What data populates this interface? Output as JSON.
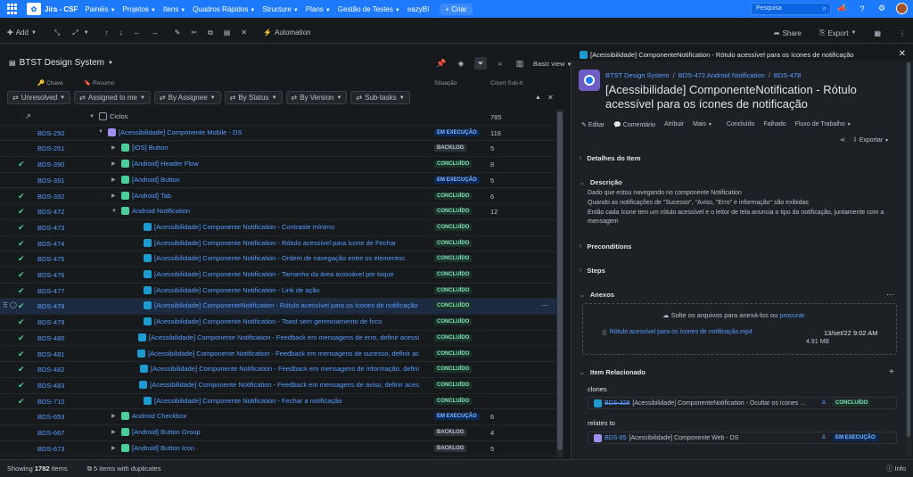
{
  "topnav": {
    "app_name": "Jira - CSF",
    "items": [
      "Painéis",
      "Projetos",
      "Itens",
      "Quadros Rápidos",
      "Structure",
      "Plans",
      "Gestão de Testes",
      "eazyBI"
    ],
    "create_label": "+ Criar",
    "search_placeholder": "Pesquisa"
  },
  "toolbar": {
    "add_label": "Add",
    "automation_label": "Automation",
    "share_label": "Share",
    "export_label": "Export"
  },
  "structure": {
    "title": "BTST Design System",
    "view_label": "Basic view",
    "columns": {
      "key": "Chave",
      "summary": "Resumo",
      "status": "Situação",
      "count": "Count Sub-It"
    },
    "filters": [
      "Unresolved",
      "Assigned to me",
      "By Assignee",
      "By Status",
      "By Version",
      "Sub-tasks"
    ]
  },
  "rows": [
    {
      "check": false,
      "key": "",
      "level": 0,
      "expand": "down",
      "type": "folder",
      "summary": "Ciclos",
      "link": false,
      "status": "",
      "st": "",
      "count": "785"
    },
    {
      "check": false,
      "key": "BDS-250",
      "level": 1,
      "expand": "down",
      "type": "epic",
      "summary": "[Acessibilidade] Componente Mobile - DS",
      "link": true,
      "status": "EM EXECUÇÃO",
      "st": "prog",
      "count": "116"
    },
    {
      "check": false,
      "key": "BDS-251",
      "level": 2,
      "expand": "right",
      "type": "story",
      "summary": "[iOS] Button",
      "link": true,
      "status": "BACKLOG",
      "st": "back",
      "count": "5"
    },
    {
      "check": true,
      "key": "BDS-390",
      "level": 2,
      "expand": "right",
      "type": "story",
      "summary": "[Android] Header Flow",
      "link": true,
      "status": "CONCLUÍDO",
      "st": "done",
      "count": "8"
    },
    {
      "check": false,
      "key": "BDS-391",
      "level": 2,
      "expand": "right",
      "type": "story",
      "summary": "[Android] Button",
      "link": true,
      "status": "EM EXECUÇÃO",
      "st": "prog",
      "count": "5"
    },
    {
      "check": true,
      "key": "BDS-392",
      "level": 2,
      "expand": "right",
      "type": "story",
      "summary": "[Android] Tab",
      "link": true,
      "status": "CONCLUÍDO",
      "st": "done",
      "count": "6"
    },
    {
      "check": true,
      "key": "BDS-472",
      "level": 2,
      "expand": "down",
      "type": "story",
      "summary": "Android Notification",
      "link": true,
      "status": "CONCLUÍDO",
      "st": "done",
      "count": "12"
    },
    {
      "check": true,
      "key": "BDS-473",
      "level": 3,
      "expand": "",
      "type": "sub",
      "summary": "[Acessibilidade] Componente Notification - Contraste mínimo",
      "link": true,
      "status": "CONCLUÍDO",
      "st": "done",
      "count": ""
    },
    {
      "check": true,
      "key": "BDS-474",
      "level": 3,
      "expand": "",
      "type": "sub",
      "summary": "[Acessibilidade] Componente Notification - Rótulo acessível para ícone de Fechar",
      "link": true,
      "status": "CONCLUÍDO",
      "st": "done",
      "count": ""
    },
    {
      "check": true,
      "key": "BDS-475",
      "level": 3,
      "expand": "",
      "type": "sub",
      "summary": "[Acessibilidade] Componente Notification - Ordem de navegação entre os elementos",
      "link": true,
      "status": "CONCLUÍDO",
      "st": "done",
      "count": ""
    },
    {
      "check": true,
      "key": "BDS-476",
      "level": 3,
      "expand": "",
      "type": "sub",
      "summary": "[Acessibilidade] Componente Notification - Tamanho da área acionável por toque",
      "link": true,
      "status": "CONCLUÍDO",
      "st": "done",
      "count": ""
    },
    {
      "check": true,
      "key": "BDS-477",
      "level": 3,
      "expand": "",
      "type": "sub",
      "summary": "[Acessibilidade] Componente Notification - Link de ação",
      "link": true,
      "status": "CONCLUÍDO",
      "st": "done",
      "count": ""
    },
    {
      "check": true,
      "key": "BDS-478",
      "level": 3,
      "expand": "",
      "type": "sub",
      "summary": "[Acessibilidade] ComponenteNotification - Rótulo acessível para os ícones de notificação",
      "link": true,
      "status": "CONCLUÍDO",
      "st": "done",
      "count": "",
      "selected": true
    },
    {
      "check": true,
      "key": "BDS-479",
      "level": 3,
      "expand": "",
      "type": "sub",
      "summary": "[Acessibilidade] Componente Notification - Toast sem gerenciamento de foco",
      "link": true,
      "status": "CONCLUÍDO",
      "st": "done",
      "count": ""
    },
    {
      "check": true,
      "key": "BDS-480",
      "level": 3,
      "expand": "",
      "type": "sub",
      "summary": "[Acessibilidade] Componente Notification - Feedback em mensagens de erro, definir acessi",
      "link": true,
      "status": "CONCLUÍDO",
      "st": "done",
      "count": ""
    },
    {
      "check": true,
      "key": "BDS-481",
      "level": 3,
      "expand": "",
      "type": "sub",
      "summary": "[Acessibilidade] Componente Notification - Feedback em mensagens de sucesso, definir ac",
      "link": true,
      "status": "CONCLUÍDO",
      "st": "done",
      "count": ""
    },
    {
      "check": true,
      "key": "BDS-482",
      "level": 3,
      "expand": "",
      "type": "sub",
      "summary": "[Acessibilidade] Componente Notification - Feedback em mensagens de informação, defini",
      "link": true,
      "status": "CONCLUÍDO",
      "st": "done",
      "count": ""
    },
    {
      "check": true,
      "key": "BDS-483",
      "level": 3,
      "expand": "",
      "type": "sub",
      "summary": "[Acessibilidade] Componente Notification - Feedback em mensagens de aviso, definir aces",
      "link": true,
      "status": "CONCLUÍDO",
      "st": "done",
      "count": ""
    },
    {
      "check": true,
      "key": "BDS-710",
      "level": 3,
      "expand": "",
      "type": "sub",
      "summary": "[Acessibilidade] Componente Notification - Fechar a notificação",
      "link": true,
      "status": "CONCLUÍDO",
      "st": "done",
      "count": ""
    },
    {
      "check": false,
      "key": "BDS-653",
      "level": 2,
      "expand": "right",
      "type": "story",
      "summary": "Android Checkbox",
      "link": true,
      "status": "EM EXECUÇÃO",
      "st": "prog",
      "count": "6"
    },
    {
      "check": false,
      "key": "BDS-667",
      "level": 2,
      "expand": "right",
      "type": "story",
      "summary": "[Android] Button Group",
      "link": true,
      "status": "BACKLOG",
      "st": "back",
      "count": "4"
    },
    {
      "check": false,
      "key": "BDS-673",
      "level": 2,
      "expand": "right",
      "type": "story",
      "summary": "[Android] Button Icon",
      "link": true,
      "status": "BACKLOG",
      "st": "back",
      "count": "5"
    }
  ],
  "footer": {
    "showing_prefix": "Showing",
    "showing_count": "1782",
    "showing_suffix": "items",
    "duplicates": "5 items with duplicates",
    "info": "Info"
  },
  "detail": {
    "titlebar": "[Acessibilidade] ComponenteNotification - Rótulo acessível para os ícones de notificação",
    "crumbs": [
      "BTST Design System",
      "BDS-472 Android Notification",
      "BDS-478"
    ],
    "title": "[Acessibilidade] ComponenteNotification - Rótulo acessível para os ícones de notificação",
    "actions": [
      "Editar",
      "Comentário",
      "Atribuir",
      "Mais",
      "Concluído",
      "Falhado",
      "Fluxo de Trabalho"
    ],
    "export_label": "Exportar",
    "sections": {
      "details": "Detalhes do Item",
      "description": "Descrição",
      "preconditions": "Preconditions",
      "steps": "Steps",
      "attachments": "Anexos",
      "related": "Item Relacionado"
    },
    "description": [
      "Dado que estou navegando no componente Notification",
      "Quando as notificações de \"Sucesso\", \"Aviso, \"Erro\" e informação\" são exibidas",
      "Então cada ícone tem um rótulo acessível e o leitor de tela anuncia o tipo da notificação, juntamente com a mensagem"
    ],
    "attachment": {
      "drop_text": "Solte os arquivos para anexá-los ou",
      "drop_link": "procurar.",
      "file_name": "Rótulo acessível para os ícones de notificação.mp4",
      "file_date": "13/set/22 9:02 AM",
      "file_size": "4.91 MB"
    },
    "relations": [
      {
        "type": "clones",
        "key": "BDS-329",
        "strike": true,
        "summary": "[Acessibilidade] ComponenteNotification - Ocultar os ícones ...",
        "status": "CONCLUÍDO",
        "st": "done"
      },
      {
        "type": "relates to",
        "key": "BDS-65",
        "strike": false,
        "summary": "[Acessibilidade] Componente Web - DS",
        "status": "EM EXECUÇÃO",
        "st": "prog"
      }
    ]
  },
  "colors": {
    "accent": "#1d7afc",
    "done": "#4bce97",
    "link": "#579dff"
  }
}
